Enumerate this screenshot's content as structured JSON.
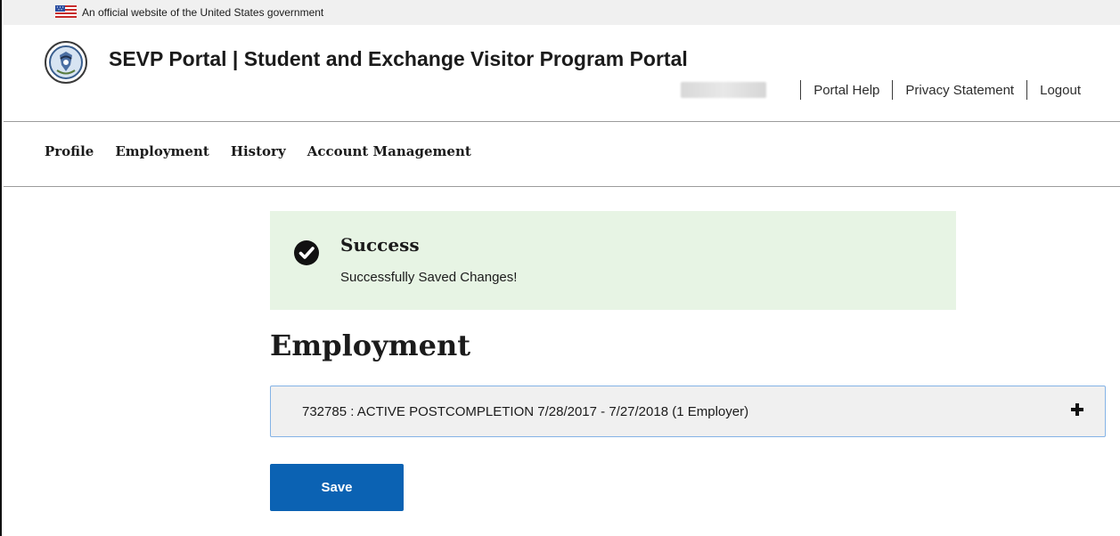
{
  "banner": {
    "text": "An official website of the United States government",
    "icon": "us-flag-icon"
  },
  "header": {
    "seal_icon": "dhs-seal-icon",
    "title": "SEVP Portal | Student and Exchange Visitor Program Portal",
    "links": [
      {
        "label": "Portal Help"
      },
      {
        "label": "Privacy Statement"
      },
      {
        "label": "Logout"
      }
    ]
  },
  "nav": {
    "items": [
      {
        "label": "Profile"
      },
      {
        "label": "Employment"
      },
      {
        "label": "History"
      },
      {
        "label": "Account Management"
      }
    ]
  },
  "alert": {
    "icon": "check-circle-icon",
    "title": "Success",
    "message": "Successfully Saved Changes!",
    "background": "#e7f4e4"
  },
  "main": {
    "title": "Employment",
    "accordion": {
      "label": "732785 : ACTIVE POSTCOMPLETION 7/28/2017 - 7/27/2018 (1 Employer)",
      "icon": "plus-icon"
    },
    "save_label": "Save"
  },
  "colors": {
    "button": "#0b62b3",
    "text": "#1b1b1b",
    "focus_border": "#84b3e6"
  }
}
